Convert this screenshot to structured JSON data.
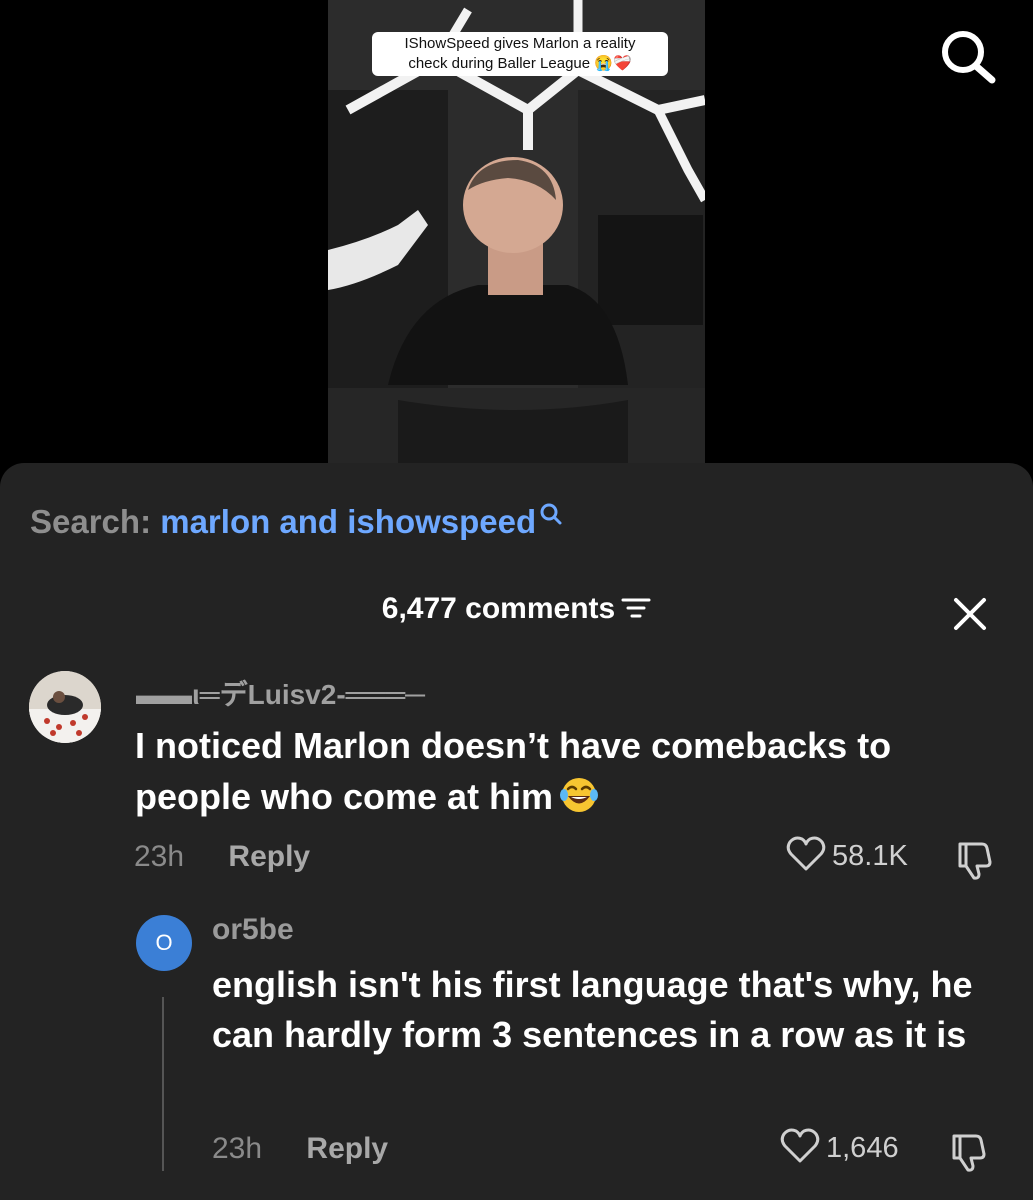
{
  "video": {
    "caption_line1": "IShowSpeed gives Marlon a reality",
    "caption_line2": "check during Baller League",
    "caption_emoji": "😭❤️‍🩹"
  },
  "header": {
    "search_prefix": "Search:",
    "search_term": "marlon and ishowspeed",
    "comments_count": "6,477 comments"
  },
  "comments": [
    {
      "username": "▬▬ι═デLuisv2-═══─",
      "text_line1": "I noticed Marlon doesn’t have comebacks to",
      "text_line2": "people who come at him",
      "emoji": "😂",
      "time": "23h",
      "reply_label": "Reply",
      "likes": "58.1K"
    },
    {
      "avatar_letter": "O",
      "username": "or5be",
      "text": "english isn't his first language that's why, he can hardly form 3 sentences in a row as it is",
      "time": "23h",
      "reply_label": "Reply",
      "likes": "1,646"
    }
  ],
  "icons": {
    "search": "search-icon",
    "filter": "filter-icon",
    "close": "close-icon",
    "heart": "heart-icon",
    "dislike": "dislike-icon"
  },
  "colors": {
    "sheet_bg": "#232323",
    "search_term": "#6ea8ff",
    "avatar_blue": "#3b7fd6"
  }
}
